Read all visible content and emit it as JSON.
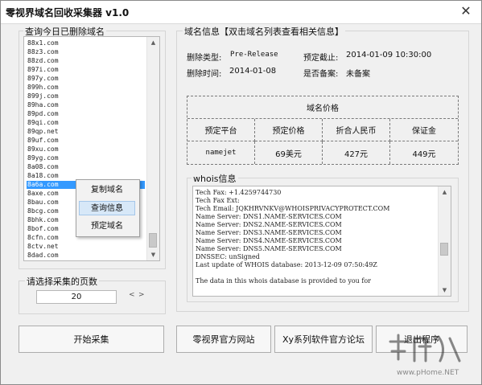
{
  "window": {
    "title": "零视界域名回收采集器 v1.0",
    "close_label": "✕"
  },
  "left_group": {
    "title": "查询今日已删除域名",
    "domains": [
      "88x1.com",
      "88z3.com",
      "88zd.com",
      "897i.com",
      "897y.com",
      "899h.com",
      "899j.com",
      "89ha.com",
      "89pd.com",
      "89qi.com",
      "89qp.net",
      "89uf.com",
      "89xu.com",
      "89yg.com",
      "8a08.com",
      "8a18.com",
      "8a6a.com",
      "8axe.com",
      "8bau.com",
      "8bcg.com",
      "8bhk.com",
      "8bof.com",
      "8cfn.com",
      "8ctv.net",
      "8dad.com"
    ],
    "selected_index": 16,
    "context_menu": [
      "复制域名",
      "查询信息",
      "预定域名"
    ],
    "context_highlight_index": 1
  },
  "pages_group": {
    "title": "请选择采集的页数",
    "value": "20",
    "prev_label": "<",
    "next_label": ">"
  },
  "domain_info": {
    "title": "域名信息【双击域名列表查看相关信息】",
    "delete_type_label": "删除类型:",
    "delete_type_value": "Pre-Release",
    "reserve_deadline_label": "预定截止:",
    "reserve_deadline_value": "2014-01-09 10:30:00",
    "delete_time_label": "删除时间:",
    "delete_time_value": "2014-01-08",
    "icp_label": "是否备案:",
    "icp_value": "未备案"
  },
  "price_table": {
    "title": "域名价格",
    "headers": [
      "预定平台",
      "预定价格",
      "折合人民币",
      "保证金"
    ],
    "row": [
      "namejet",
      "69美元",
      "427元",
      "449元"
    ]
  },
  "whois": {
    "title": "whois信息",
    "lines": [
      "Tech Fax: +1.4259744730",
      "Tech Fax Ext:",
      "Tech Email: JQKHRVNKV@WHOISPRIVACYPROTECT.COM",
      "Name Server: DNS1.NAME-SERVICES.COM",
      "Name Server: DNS2.NAME-SERVICES.COM",
      "Name Server: DNS3.NAME-SERVICES.COM",
      "Name Server: DNS4.NAME-SERVICES.COM",
      "Name Server: DNS5.NAME-SERVICES.COM",
      "DNSSEC: unSigned",
      "Last update of WHOIS database: 2013-12-09 07:50:49Z",
      "",
      "The data in this whois database is provided to you for"
    ]
  },
  "buttons": {
    "start": "开始采集",
    "official_site": "零视界官方网站",
    "forum": "Xy系列软件官方论坛",
    "exit": "退出程序"
  },
  "watermark": {
    "site": "www.pHome.NET",
    "logo_text": "下载"
  }
}
